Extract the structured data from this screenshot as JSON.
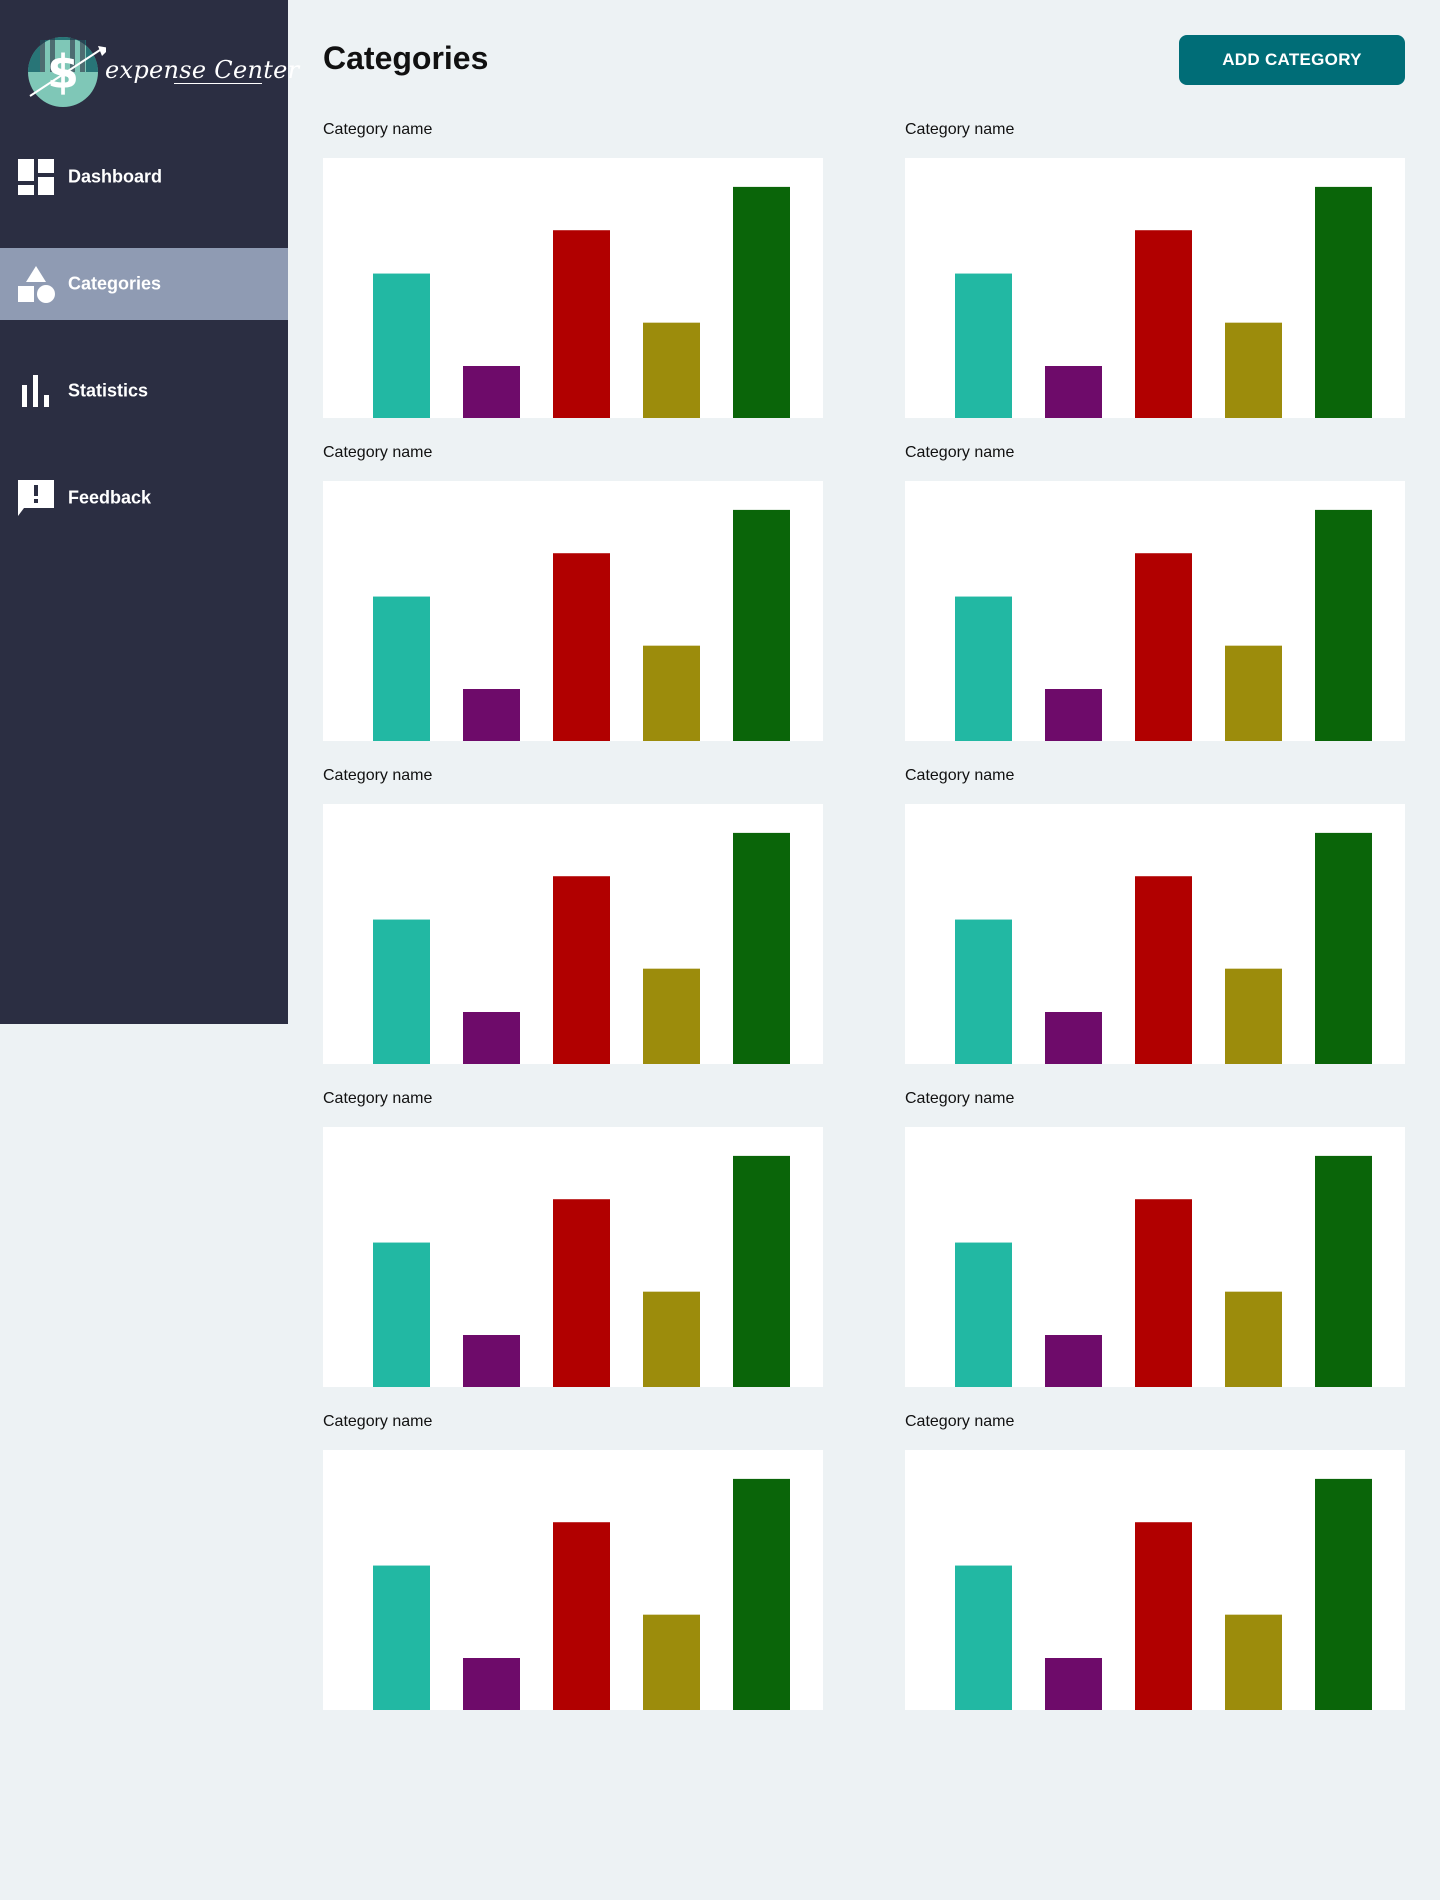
{
  "app": {
    "logo_text": "expense Center"
  },
  "sidebar": {
    "items": [
      {
        "label": "Dashboard",
        "icon": "dashboard-icon",
        "active": false
      },
      {
        "label": "Categories",
        "icon": "shapes-icon",
        "active": true
      },
      {
        "label": "Statistics",
        "icon": "bar-chart-icon",
        "active": false
      },
      {
        "label": "Feedback",
        "icon": "feedback-icon",
        "active": false
      }
    ]
  },
  "header": {
    "title": "Categories",
    "add_button_label": "ADD CATEGORY"
  },
  "colors": {
    "sidebar_bg": "#2b2e42",
    "active_item_bg": "#8f9bb3",
    "accent": "#006d77",
    "page_bg": "#edf2f4"
  },
  "categories": [
    {
      "label": "Category name"
    },
    {
      "label": "Category name"
    },
    {
      "label": "Category name"
    },
    {
      "label": "Category name"
    },
    {
      "label": "Category name"
    },
    {
      "label": "Category name"
    },
    {
      "label": "Category name"
    },
    {
      "label": "Category name"
    },
    {
      "label": "Category name"
    },
    {
      "label": "Category name"
    }
  ],
  "chart_data": {
    "type": "bar",
    "values": [
      50,
      18,
      65,
      33,
      80
    ],
    "colors": [
      "#22b8a3",
      "#6e0b6a",
      "#b10000",
      "#9c8c0c",
      "#0a6509"
    ],
    "ylim": [
      0,
      90
    ],
    "grid": false,
    "legend": "none"
  }
}
